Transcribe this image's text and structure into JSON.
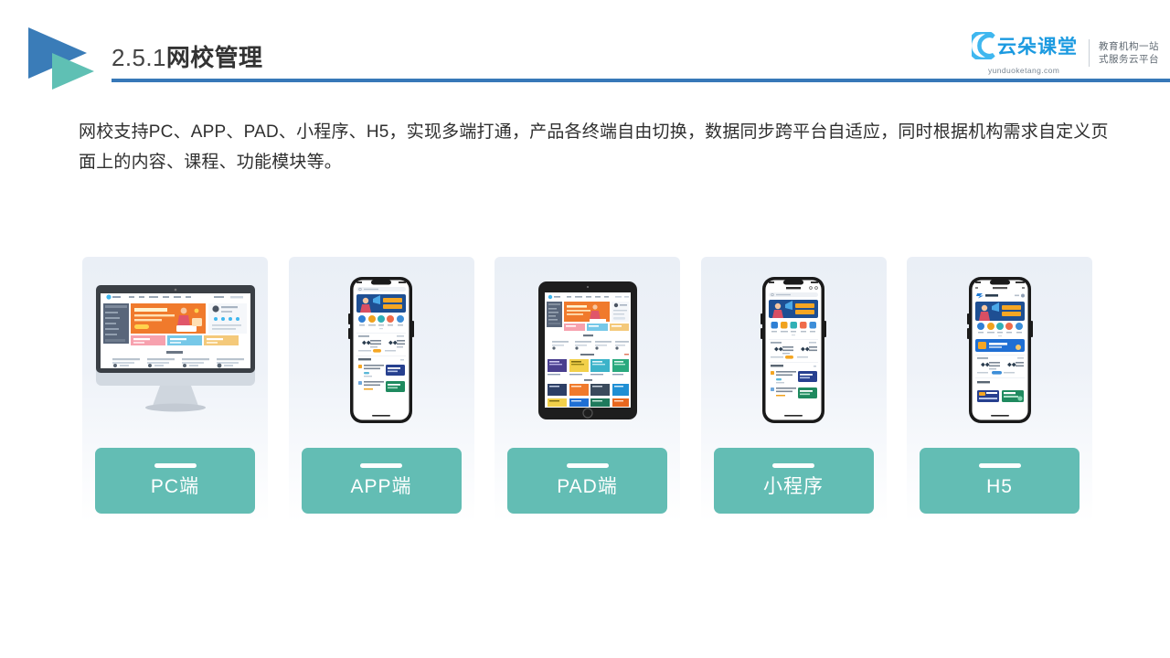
{
  "header": {
    "title_number": "2.5.1",
    "title_name": "网校管理",
    "logo_icon": "play-triangle-logo",
    "rule_color": "#3778b8"
  },
  "brand": {
    "cloud_icon": "cloud-c-icon",
    "name": "云朵课堂",
    "url": "yunduoketang.com",
    "tagline_line1": "教育机构一站",
    "tagline_line2": "式服务云平台",
    "name_color": "#1b9ae0"
  },
  "body": {
    "paragraph": "网校支持PC、APP、PAD、小程序、H5，实现多端打通，产品各终端自由切换，数据同步跨平台自适应，同时根据机构需求自定义页面上的内容、课程、功能模块等。"
  },
  "cards": [
    {
      "label": "PC端",
      "device": "desktop-monitor",
      "device_icon": "imac-icon"
    },
    {
      "label": "APP端",
      "device": "phone-notch",
      "device_icon": "iphone-icon"
    },
    {
      "label": "PAD端",
      "device": "tablet",
      "device_icon": "ipad-icon"
    },
    {
      "label": "小程序",
      "device": "phone-notch-nav",
      "device_icon": "iphone-miniprogram-icon"
    },
    {
      "label": "H5",
      "device": "phone-notch-web",
      "device_icon": "iphone-h5-icon"
    }
  ],
  "theme": {
    "accent_teal": "#63bdb4",
    "accent_blue": "#3778b8",
    "card_background_top": "#eaeff6",
    "card_background_bottom": "#ffffff"
  }
}
